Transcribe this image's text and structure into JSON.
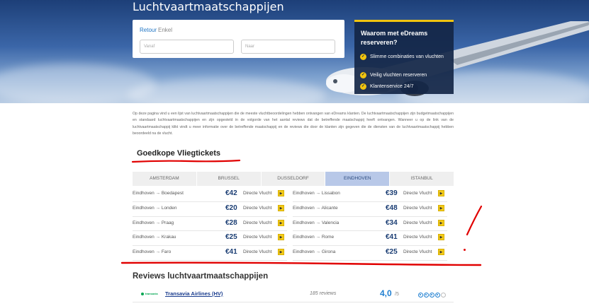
{
  "hero": {
    "title": "Luchtvaartmaatschappijen",
    "search": {
      "tab_retour": "Retour",
      "tab_enkel": "Enkel",
      "from_placeholder": "Vanaf",
      "to_placeholder": "Naar"
    },
    "why": {
      "title": "Waarom met eDreams reserveren?",
      "items": [
        "Slimme combinaties van vluchten",
        "Veilig vluchten reserveren",
        "Klantenservice 24/7"
      ]
    }
  },
  "intro_text": "Op deze pagina vind u een lijst van luchtvaartmaatschappijen die de meeste vluchtbeoordelingen hebben ontvangen van eDreams klanten. De luchtvaartmaatschappijen zijn budgetmaatschappijen en standaard luchtvaartmaatschappijen en zijn opgesteld in de volgorde van het aantal reviews dat de betreffende maatschappij heeft ontvangen. Wanneer u op de link van de luchtvaartmaatschappij klikt vindt u meer informatie over de betreffende maatschappij en de reviews die door de klanten zijn gegeven die de diensten van de luchtvaartmaatschappij hebben beoordeeld na de vlucht.",
  "cheap_tickets": {
    "title": "Goedkope Vliegtickets",
    "cities": [
      {
        "label": "AMSTERDAM",
        "active": false
      },
      {
        "label": "BRUSSEL",
        "active": false
      },
      {
        "label": "DUSSELDORF",
        "active": false
      },
      {
        "label": "EINDHOVEN",
        "active": true
      },
      {
        "label": "ISTANBUL",
        "active": false
      }
    ],
    "left_routes": [
      {
        "route": "Eindhoven → Boedapest",
        "price": "€42",
        "type": "Directe Vlucht"
      },
      {
        "route": "Eindhoven → Londen",
        "price": "€20",
        "type": "Directe Vlucht"
      },
      {
        "route": "Eindhoven → Praag",
        "price": "€28",
        "type": "Directe Vlucht"
      },
      {
        "route": "Eindhoven → Krakau",
        "price": "€25",
        "type": "Directe Vlucht"
      },
      {
        "route": "Eindhoven → Faro",
        "price": "€41",
        "type": "Directe Vlucht"
      }
    ],
    "right_routes": [
      {
        "route": "Eindhoven → Lissabon",
        "price": "€39",
        "type": "Directe Vlucht"
      },
      {
        "route": "Eindhoven → Alicante",
        "price": "€48",
        "type": "Directe Vlucht"
      },
      {
        "route": "Eindhoven → Valencia",
        "price": "€34",
        "type": "Directe Vlucht"
      },
      {
        "route": "Eindhoven → Rome",
        "price": "€41",
        "type": "Directe Vlucht"
      },
      {
        "route": "Eindhoven → Girona",
        "price": "€25",
        "type": "Directe Vlucht"
      }
    ],
    "go_icon": "arrow-right-icon",
    "go_glyph": "▶"
  },
  "reviews": {
    "title": "Reviews luchtvaartmaatschappijen",
    "items": [
      {
        "logo_text": "transavia",
        "name": "Transavia Airlines (HV)",
        "count": "185 reviews",
        "score": "4,0",
        "max": "/5",
        "rating": 4
      }
    ]
  },
  "colors": {
    "accent_yellow": "#f5cc1a",
    "price_blue": "#1a3d73",
    "active_tab": "#b8c8e8",
    "annotation_red": "#e10000"
  }
}
